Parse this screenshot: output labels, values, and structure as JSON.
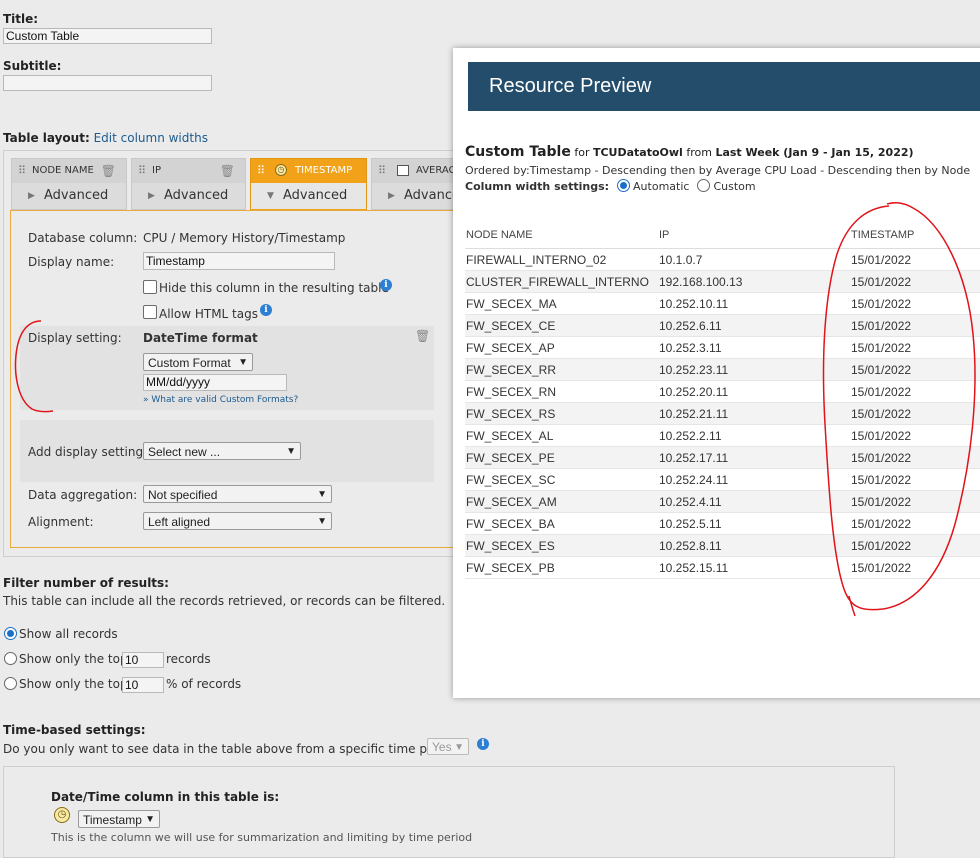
{
  "form": {
    "title_label": "Title:",
    "title_value": "Custom Table",
    "subtitle_label": "Subtitle:",
    "subtitle_value": "",
    "table_layout_label": "Table layout:",
    "edit_widths_link": "Edit column widths"
  },
  "tabs": [
    {
      "name": "NODE NAME",
      "action": "Advanced"
    },
    {
      "name": "IP",
      "action": "Advanced"
    },
    {
      "name": "TIMESTAMP",
      "action": "Advanced"
    },
    {
      "name": "AVERAG",
      "action": "Advance"
    }
  ],
  "column_settings": {
    "db_column_label": "Database column:",
    "db_column_value": "CPU / Memory History/Timestamp",
    "display_name_label": "Display name:",
    "display_name_value": "Timestamp",
    "hide_column_label": "Hide this column in the resulting table",
    "allow_html_label": "Allow HTML tags",
    "display_setting_label": "Display setting:",
    "datetime_format_label": "DateTime format",
    "format_select": "Custom Format",
    "format_value": "MM/dd/yyyy",
    "custom_formats_link": "» What are valid Custom Formats?",
    "add_display_label": "Add display settings:",
    "add_display_select": "Select new ...",
    "aggregation_label": "Data aggregation:",
    "aggregation_select": "Not specified",
    "alignment_label": "Alignment:",
    "alignment_select": "Left aligned"
  },
  "filter": {
    "heading": "Filter number of results:",
    "description": "This table can include all the records retrieved, or records can be filtered.",
    "show_all": "Show all records",
    "top_prefix": "Show only the top",
    "top_value": "10",
    "top_suffix": "records",
    "pct_prefix": "Show only the top",
    "pct_value": "10",
    "pct_suffix": "% of records"
  },
  "time": {
    "heading": "Time-based settings:",
    "question": "Do you only want to see data in the table above from a specific time period?",
    "answer": "Yes",
    "datetime_col_label": "Date/Time column in this table is:",
    "datetime_col_select": "Timestamp",
    "note": "This is the column we will use for summarization and limiting by time period"
  },
  "preview": {
    "header": "Resource Preview",
    "table_title": "Custom Table",
    "for_word": "for",
    "entity": "TCUDatatoOwl",
    "from_word": "from",
    "period": "Last Week (Jan 9 - Jan 15, 2022)",
    "ordered_by": "Ordered by:Timestamp - Descending then by Average CPU Load - Descending then by Node",
    "width_label": "Column width settings:",
    "width_auto": "Automatic",
    "width_custom": "Custom",
    "columns": [
      "NODE NAME",
      "IP",
      "TIMESTAMP"
    ],
    "rows": [
      [
        "FIREWALL_INTERNO_02",
        "10.1.0.7",
        "15/01/2022"
      ],
      [
        "CLUSTER_FIREWALL_INTERNO",
        "192.168.100.13",
        "15/01/2022"
      ],
      [
        "FW_SECEX_MA",
        "10.252.10.11",
        "15/01/2022"
      ],
      [
        "FW_SECEX_CE",
        "10.252.6.11",
        "15/01/2022"
      ],
      [
        "FW_SECEX_AP",
        "10.252.3.11",
        "15/01/2022"
      ],
      [
        "FW_SECEX_RR",
        "10.252.23.11",
        "15/01/2022"
      ],
      [
        "FW_SECEX_RN",
        "10.252.20.11",
        "15/01/2022"
      ],
      [
        "FW_SECEX_RS",
        "10.252.21.11",
        "15/01/2022"
      ],
      [
        "FW_SECEX_AL",
        "10.252.2.11",
        "15/01/2022"
      ],
      [
        "FW_SECEX_PE",
        "10.252.17.11",
        "15/01/2022"
      ],
      [
        "FW_SECEX_SC",
        "10.252.24.11",
        "15/01/2022"
      ],
      [
        "FW_SECEX_AM",
        "10.252.4.11",
        "15/01/2022"
      ],
      [
        "FW_SECEX_BA",
        "10.252.5.11",
        "15/01/2022"
      ],
      [
        "FW_SECEX_ES",
        "10.252.8.11",
        "15/01/2022"
      ],
      [
        "FW_SECEX_PB",
        "10.252.15.11",
        "15/01/2022"
      ]
    ]
  },
  "colors": {
    "active_tab": "#f2a219",
    "preview_header": "#234d6b",
    "annotation": "#e0141a",
    "link": "#1d5b8f"
  }
}
